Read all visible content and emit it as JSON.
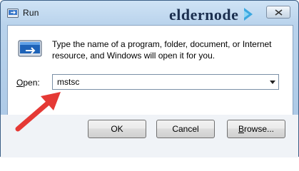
{
  "window": {
    "title": "Run",
    "title_icon": "run-app-icon",
    "close_icon": "close-icon"
  },
  "watermark": {
    "text": "eldernode"
  },
  "dialog": {
    "description": "Type the name of a program, folder, document, or Internet resource, and Windows will open it for you.",
    "open_label_prefix": "",
    "open_label_accel": "O",
    "open_label_rest": "pen:",
    "open_value": "mstsc"
  },
  "buttons": {
    "ok": "OK",
    "cancel": "Cancel",
    "browse_accel": "B",
    "browse_rest": "rowse..."
  },
  "colors": {
    "annotation_arrow": "#e53935",
    "frame_gradient_top": "#cfe3f5",
    "frame_border": "#3c5f86"
  }
}
